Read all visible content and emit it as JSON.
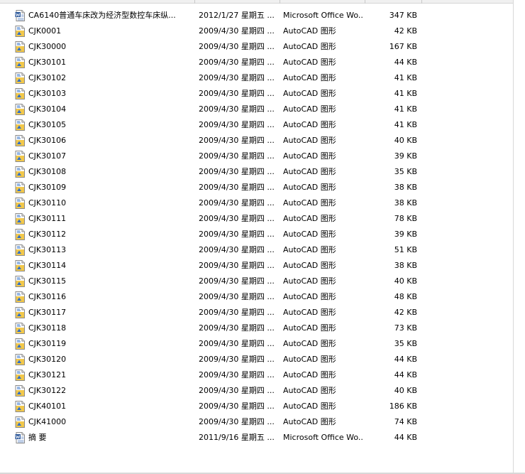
{
  "icons": {
    "autocad": "autocad-drawing-icon",
    "word": "word-document-icon"
  },
  "colors": {
    "autocad_fill": "#f2c84b",
    "autocad_accent": "#2e6fc9",
    "word_fill": "#2b579a"
  },
  "files": [
    {
      "name": "CA6140普通车床改为经济型数控车床纵...",
      "date": "2012/1/27 星期五 ...",
      "type": "Microsoft Office Wo...",
      "size": "347 KB",
      "icon": "word"
    },
    {
      "name": "CJK0001",
      "date": "2009/4/30 星期四 ...",
      "type": "AutoCAD 图形",
      "size": "42 KB",
      "icon": "autocad"
    },
    {
      "name": "CJK30000",
      "date": "2009/4/30 星期四 ...",
      "type": "AutoCAD 图形",
      "size": "167 KB",
      "icon": "autocad"
    },
    {
      "name": "CJK30101",
      "date": "2009/4/30 星期四 ...",
      "type": "AutoCAD 图形",
      "size": "44 KB",
      "icon": "autocad"
    },
    {
      "name": "CJK30102",
      "date": "2009/4/30 星期四 ...",
      "type": "AutoCAD 图形",
      "size": "41 KB",
      "icon": "autocad"
    },
    {
      "name": "CJK30103",
      "date": "2009/4/30 星期四 ...",
      "type": "AutoCAD 图形",
      "size": "41 KB",
      "icon": "autocad"
    },
    {
      "name": "CJK30104",
      "date": "2009/4/30 星期四 ...",
      "type": "AutoCAD 图形",
      "size": "41 KB",
      "icon": "autocad"
    },
    {
      "name": "CJK30105",
      "date": "2009/4/30 星期四 ...",
      "type": "AutoCAD 图形",
      "size": "41 KB",
      "icon": "autocad"
    },
    {
      "name": "CJK30106",
      "date": "2009/4/30 星期四 ...",
      "type": "AutoCAD 图形",
      "size": "40 KB",
      "icon": "autocad"
    },
    {
      "name": "CJK30107",
      "date": "2009/4/30 星期四 ...",
      "type": "AutoCAD 图形",
      "size": "39 KB",
      "icon": "autocad"
    },
    {
      "name": "CJK30108",
      "date": "2009/4/30 星期四 ...",
      "type": "AutoCAD 图形",
      "size": "35 KB",
      "icon": "autocad"
    },
    {
      "name": "CJK30109",
      "date": "2009/4/30 星期四 ...",
      "type": "AutoCAD 图形",
      "size": "38 KB",
      "icon": "autocad"
    },
    {
      "name": "CJK30110",
      "date": "2009/4/30 星期四 ...",
      "type": "AutoCAD 图形",
      "size": "38 KB",
      "icon": "autocad"
    },
    {
      "name": "CJK30111",
      "date": "2009/4/30 星期四 ...",
      "type": "AutoCAD 图形",
      "size": "78 KB",
      "icon": "autocad"
    },
    {
      "name": "CJK30112",
      "date": "2009/4/30 星期四 ...",
      "type": "AutoCAD 图形",
      "size": "39 KB",
      "icon": "autocad"
    },
    {
      "name": "CJK30113",
      "date": "2009/4/30 星期四 ...",
      "type": "AutoCAD 图形",
      "size": "51 KB",
      "icon": "autocad"
    },
    {
      "name": "CJK30114",
      "date": "2009/4/30 星期四 ...",
      "type": "AutoCAD 图形",
      "size": "38 KB",
      "icon": "autocad"
    },
    {
      "name": "CJK30115",
      "date": "2009/4/30 星期四 ...",
      "type": "AutoCAD 图形",
      "size": "40 KB",
      "icon": "autocad"
    },
    {
      "name": "CJK30116",
      "date": "2009/4/30 星期四 ...",
      "type": "AutoCAD 图形",
      "size": "48 KB",
      "icon": "autocad"
    },
    {
      "name": "CJK30117",
      "date": "2009/4/30 星期四 ...",
      "type": "AutoCAD 图形",
      "size": "42 KB",
      "icon": "autocad"
    },
    {
      "name": "CJK30118",
      "date": "2009/4/30 星期四 ...",
      "type": "AutoCAD 图形",
      "size": "73 KB",
      "icon": "autocad"
    },
    {
      "name": "CJK30119",
      "date": "2009/4/30 星期四 ...",
      "type": "AutoCAD 图形",
      "size": "35 KB",
      "icon": "autocad"
    },
    {
      "name": "CJK30120",
      "date": "2009/4/30 星期四 ...",
      "type": "AutoCAD 图形",
      "size": "44 KB",
      "icon": "autocad"
    },
    {
      "name": "CJK30121",
      "date": "2009/4/30 星期四 ...",
      "type": "AutoCAD 图形",
      "size": "44 KB",
      "icon": "autocad"
    },
    {
      "name": "CJK30122",
      "date": "2009/4/30 星期四 ...",
      "type": "AutoCAD 图形",
      "size": "40 KB",
      "icon": "autocad"
    },
    {
      "name": "CJK40101",
      "date": "2009/4/30 星期四 ...",
      "type": "AutoCAD 图形",
      "size": "186 KB",
      "icon": "autocad"
    },
    {
      "name": "CJK41000",
      "date": "2009/4/30 星期四 ...",
      "type": "AutoCAD 图形",
      "size": "74 KB",
      "icon": "autocad"
    },
    {
      "name": "摘 要",
      "date": "2011/9/16 星期五 ...",
      "type": "Microsoft Office Wo...",
      "size": "44 KB",
      "icon": "word"
    }
  ]
}
